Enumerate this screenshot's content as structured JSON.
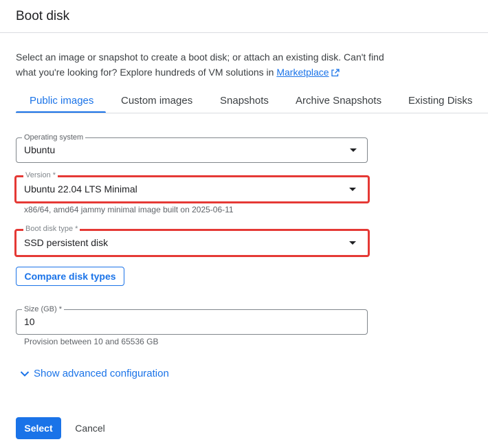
{
  "panel": {
    "title": "Boot disk",
    "description": "Select an image or snapshot to create a boot disk; or attach an existing disk. Can't find what you're looking for? Explore hundreds of VM solutions in",
    "marketplace_link": "Marketplace"
  },
  "tabs": [
    {
      "label": "Public images",
      "active": true
    },
    {
      "label": "Custom images",
      "active": false
    },
    {
      "label": "Snapshots",
      "active": false
    },
    {
      "label": "Archive Snapshots",
      "active": false
    },
    {
      "label": "Existing Disks",
      "active": false
    }
  ],
  "form": {
    "operating_system": {
      "label": "Operating system",
      "value": "Ubuntu"
    },
    "version": {
      "label": "Version *",
      "value": "Ubuntu 22.04 LTS Minimal",
      "hint": "x86/64, amd64 jammy minimal image built on 2025-06-11"
    },
    "boot_disk_type": {
      "label": "Boot disk type *",
      "value": "SSD persistent disk"
    },
    "compare_button": "Compare disk types",
    "size": {
      "label": "Size (GB) *",
      "value": "10",
      "hint": "Provision between 10 and 65536 GB"
    },
    "advanced_toggle": "Show advanced configuration"
  },
  "actions": {
    "select_label": "Select",
    "cancel_label": "Cancel"
  },
  "colors": {
    "accent": "#1a73e8",
    "highlight_border": "#e53935"
  },
  "icons": {
    "external_link": "external-link-icon",
    "expand": "chevron-down-icon",
    "dropdown": "dropdown-arrow-icon"
  }
}
